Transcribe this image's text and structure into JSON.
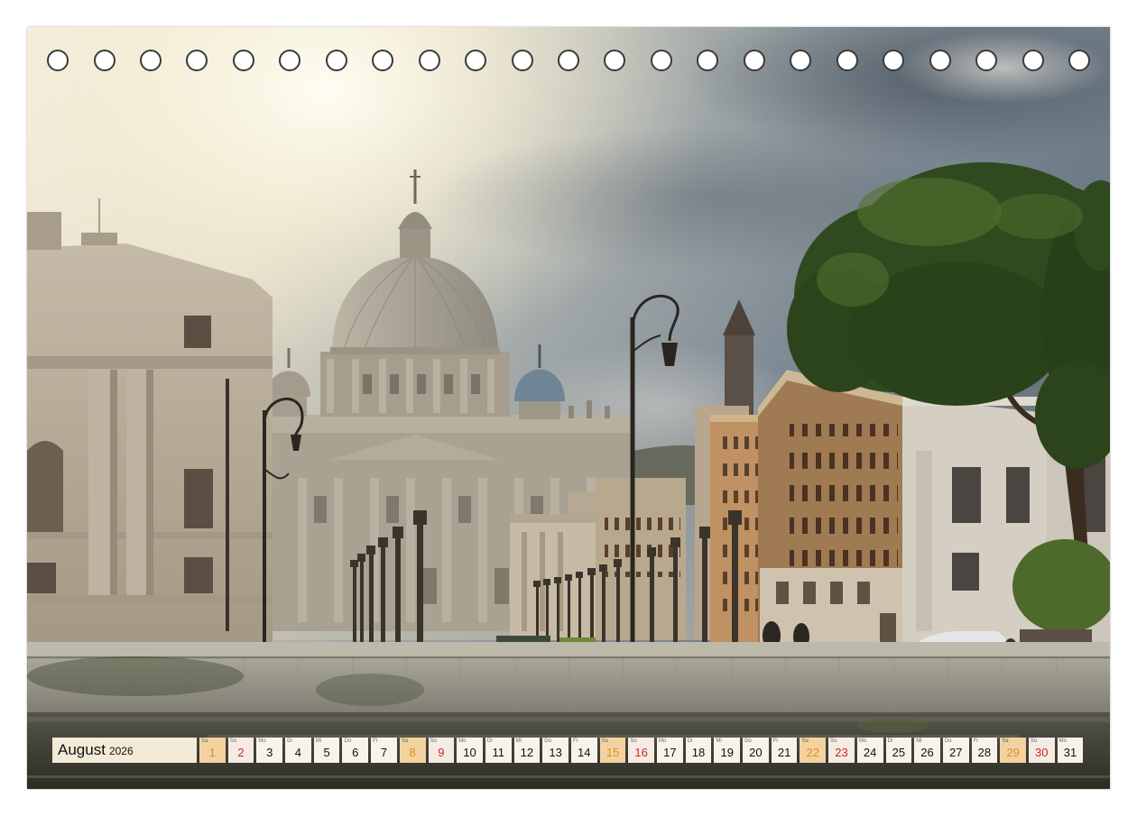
{
  "calendar": {
    "month": "August",
    "year": "2026",
    "days": [
      {
        "wd": "Sa",
        "day": 1
      },
      {
        "wd": "So",
        "day": 2
      },
      {
        "wd": "Mo",
        "day": 3
      },
      {
        "wd": "Di",
        "day": 4
      },
      {
        "wd": "Mi",
        "day": 5
      },
      {
        "wd": "Do",
        "day": 6
      },
      {
        "wd": "Fr",
        "day": 7
      },
      {
        "wd": "Sa",
        "day": 8
      },
      {
        "wd": "So",
        "day": 9
      },
      {
        "wd": "Mo",
        "day": 10
      },
      {
        "wd": "Di",
        "day": 11
      },
      {
        "wd": "Mi",
        "day": 12
      },
      {
        "wd": "Do",
        "day": 13
      },
      {
        "wd": "Fr",
        "day": 14
      },
      {
        "wd": "Sa",
        "day": 15
      },
      {
        "wd": "So",
        "day": 16
      },
      {
        "wd": "Mo",
        "day": 17
      },
      {
        "wd": "Di",
        "day": 18
      },
      {
        "wd": "Mi",
        "day": 19
      },
      {
        "wd": "Do",
        "day": 20
      },
      {
        "wd": "Fr",
        "day": 21
      },
      {
        "wd": "Sa",
        "day": 22
      },
      {
        "wd": "So",
        "day": 23
      },
      {
        "wd": "Mo",
        "day": 24
      },
      {
        "wd": "Di",
        "day": 25
      },
      {
        "wd": "Mi",
        "day": 26
      },
      {
        "wd": "Do",
        "day": 27
      },
      {
        "wd": "Fr",
        "day": 28
      },
      {
        "wd": "Sa",
        "day": 29
      },
      {
        "wd": "So",
        "day": 30
      },
      {
        "wd": "Mo",
        "day": 31
      }
    ]
  },
  "colors": {
    "label_bg": "#f3ebd7",
    "weekday_bg": "#f7f3ea",
    "weekday_text": "#111111",
    "saturday_bg": "#f2d3a0",
    "saturday_text": "#e58a1f",
    "sunday_bg": "#f6ebe4",
    "sunday_text": "#cc2a1e"
  }
}
